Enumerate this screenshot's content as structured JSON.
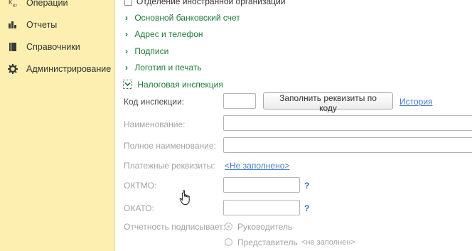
{
  "sidebar": {
    "items": [
      {
        "label": "Операции",
        "icon": "operations-icon"
      },
      {
        "label": "Отчеты",
        "icon": "bar-chart-icon"
      },
      {
        "label": "Справочники",
        "icon": "book-icon"
      },
      {
        "label": "Администрирование",
        "icon": "gear-icon"
      }
    ]
  },
  "form": {
    "foreign_org_label": "Отделение иностранной организации",
    "sections": [
      "Основной банковский счет",
      "Адрес и телефон",
      "Подписи",
      "Логотип и печать"
    ],
    "tax_section_label": "Налоговая инспекция",
    "inspection_code_label": "Код инспекции:",
    "inspection_code_value": "",
    "fill_button_label": "Заполнить реквизиты по коду",
    "history_link": "История",
    "name_label": "Наименование:",
    "full_name_label": "Полное наименование:",
    "payment_label": "Платежные реквизиты:",
    "payment_link": "<Не заполнено>",
    "oktmo_label": "ОКТМО:",
    "okato_label": "ОКАТО:",
    "help_mark": "?",
    "signer_label": "Отчетность подписывает:",
    "signer_option_1": "Руководитель",
    "signer_option_2": "Представитель",
    "not_filled_small": "<не заполнен>"
  },
  "colors": {
    "sidebar_bg": "#fcefb0",
    "green_link": "#1d7a3a",
    "blue_link": "#4a7fc8"
  }
}
